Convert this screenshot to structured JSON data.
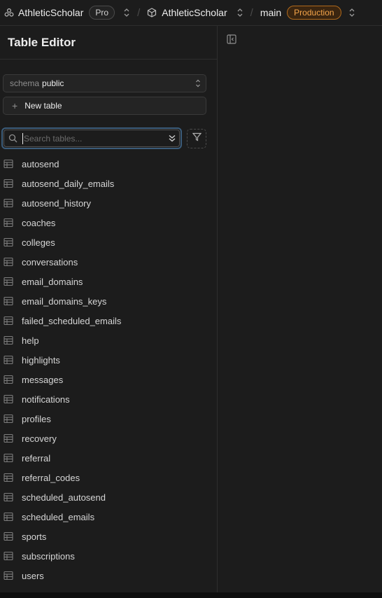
{
  "topbar": {
    "org_name": "AthleticScholar",
    "org_plan": "Pro",
    "project_name": "AthleticScholar",
    "branch_name": "main",
    "environment_badge": "Production",
    "separator": "/"
  },
  "sidebar": {
    "title": "Table Editor",
    "schema": {
      "label": "schema",
      "value": "public"
    },
    "new_table_label": "New table",
    "search": {
      "placeholder": "Search tables...",
      "value": ""
    },
    "tables": [
      "autosend",
      "autosend_daily_emails",
      "autosend_history",
      "coaches",
      "colleges",
      "conversations",
      "email_domains",
      "email_domains_keys",
      "failed_scheduled_emails",
      "help",
      "highlights",
      "messages",
      "notifications",
      "profiles",
      "recovery",
      "referral",
      "referral_codes",
      "scheduled_autosend",
      "scheduled_emails",
      "sports",
      "subscriptions",
      "users"
    ]
  },
  "colors": {
    "background": "#1c1c1c",
    "border": "#2e2e2e",
    "production_badge": "#f5a54a",
    "search_focus_ring": "#3b5c7a"
  },
  "icons": {
    "org": "org-logo-icon",
    "project": "cube-icon",
    "switcher": "chevrons-up-down-icon",
    "search": "search-icon",
    "search_expand": "chevrons-down-icon",
    "filter": "filter-icon",
    "table": "table-icon",
    "collapse": "sidebar-collapse-icon"
  }
}
